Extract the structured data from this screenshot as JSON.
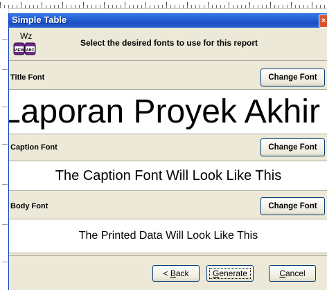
{
  "window": {
    "title": "Simple Table",
    "close_glyph": "×"
  },
  "header": {
    "icon_label_top": "Wz",
    "icon_label_left": "VIEW",
    "icon_label_right": "ABC",
    "instruction": "Select the desired fonts to use for this report"
  },
  "sections": {
    "title": {
      "label": "Title Font",
      "button": "Change Font",
      "preview": "Laporan Proyek Akhir"
    },
    "caption": {
      "label": "Caption Font",
      "button": "Change Font",
      "preview": "The Caption Font Will Look Like This"
    },
    "body": {
      "label": "Body Font",
      "button": "Change Font",
      "preview": "The Printed Data Will Look Like This"
    }
  },
  "footer": {
    "back_prefix": "< ",
    "back_key": "B",
    "back_rest": "ack",
    "generate_key": "G",
    "generate_rest": "enerate",
    "cancel_key": "C",
    "cancel_rest": "ancel"
  },
  "colors": {
    "titlebar": "#2461d6",
    "dialog_bg": "#ece9d8",
    "button_border": "#003c74"
  },
  "icons": {
    "wizard": "report-wizard-icon",
    "close": "close-icon"
  }
}
